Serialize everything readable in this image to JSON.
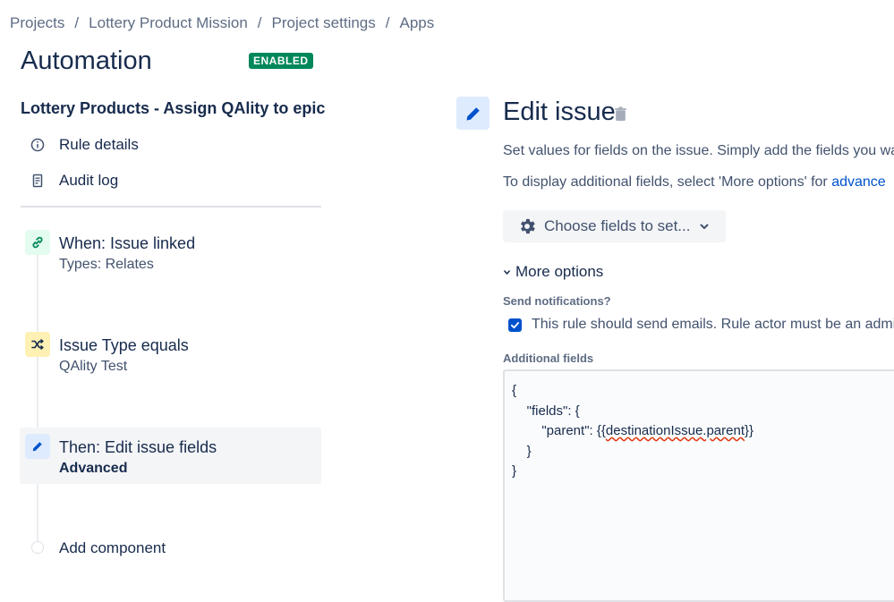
{
  "breadcrumb": [
    "Projects",
    "Lottery Product Mission",
    "Project settings",
    "Apps"
  ],
  "breadcrumb_separator": "/",
  "page": {
    "title": "Automation",
    "status_badge": "ENABLED"
  },
  "rule": {
    "name": "Lottery Products - Assign QAlity to epic"
  },
  "sidebar_links": [
    {
      "label": "Rule details",
      "icon": "info-icon"
    },
    {
      "label": "Audit log",
      "icon": "document-icon"
    }
  ],
  "steps": [
    {
      "title": "When: Issue linked",
      "subtitle": "Types: Relates",
      "icon": "link-icon",
      "color": "#e3fcef",
      "icon_color": "#00875a"
    },
    {
      "title": "Issue Type equals",
      "subtitle": "QAlity Test",
      "icon": "shuffle-icon",
      "color": "#fff0b3",
      "icon_color": "#172b4d"
    },
    {
      "title": "Then: Edit issue fields",
      "subtitle": "Advanced",
      "icon": "pencil-icon",
      "color": "#deebff",
      "icon_color": "#0052cc",
      "selected": true
    }
  ],
  "add_component": "Add component",
  "editor": {
    "title": "Edit issue",
    "description_1": "Set values for fields on the issue. Simply add the fields you wa",
    "description_2_prefix": "To display additional fields, select 'More options' for ",
    "description_2_link": "advance",
    "choose_fields_button": "Choose fields to set...",
    "more_options": "More options",
    "send_notifications_label": "Send notifications?",
    "send_notifications_text": "This rule should send emails. Rule actor must be an admi",
    "send_notifications_checked": true,
    "additional_fields_label": "Additional fields",
    "code_lines": [
      "{",
      "    \"fields\": {",
      "        \"parent\": {{destinationIssue.parent}}",
      "    }",
      "}"
    ]
  }
}
